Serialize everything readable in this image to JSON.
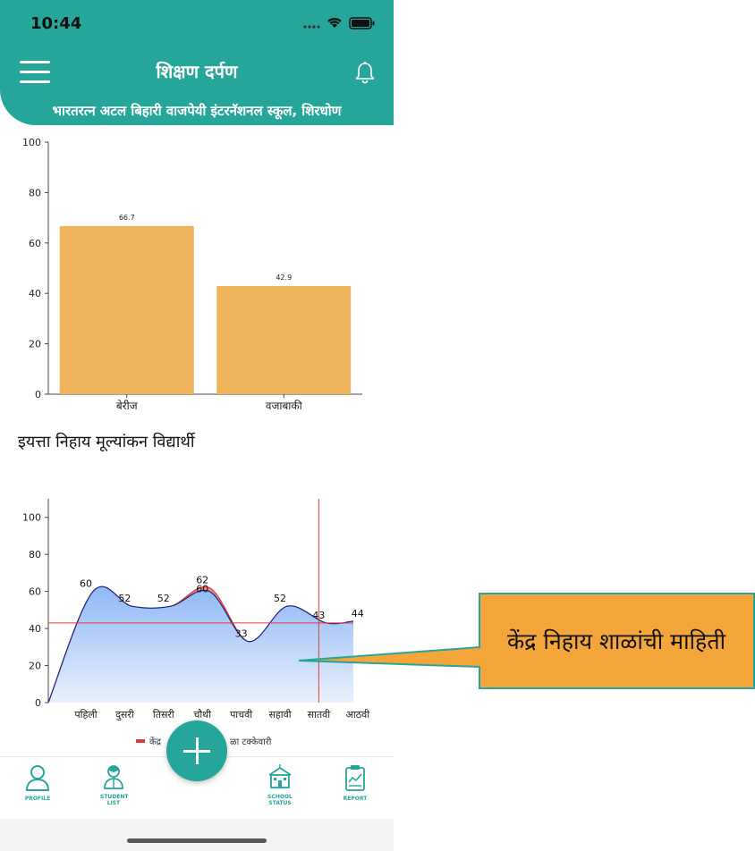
{
  "status": {
    "time": "10:44"
  },
  "header": {
    "title": "शिक्षण दर्पण",
    "school": "भारतरत्न अटल बिहारी वाजपेयी इंटरनॅशनल स्कूल, शिरधोण"
  },
  "section_label": "इयत्ता निहाय मूल्यांकन विद्यार्थी",
  "chart_data": [
    {
      "type": "bar",
      "categories": [
        "बेरीज",
        "वजाबाकी"
      ],
      "values": [
        66.7,
        42.9
      ],
      "data_labels": [
        "66.7",
        "42.9"
      ],
      "ylim": [
        0,
        100
      ],
      "yticks": [
        "0",
        "20",
        "40",
        "60",
        "80",
        "100"
      ],
      "color": "#efb35c"
    },
    {
      "type": "area",
      "categories": [
        "पहिली",
        "दुसरी",
        "तिसरी",
        "चौथी",
        "पाचवी",
        "सहावी",
        "सातवी",
        "आठवी"
      ],
      "series": [
        {
          "name": "केंद्र",
          "values": [
            60,
            52,
            52,
            62,
            33,
            52,
            43,
            44
          ],
          "color": "#e53935"
        },
        {
          "values": [
            60,
            52,
            52,
            60,
            33,
            52,
            43,
            44
          ],
          "color": "#1a237e"
        }
      ],
      "data_labels": [
        "60",
        "52",
        "52",
        "62",
        "60",
        "33",
        "52",
        "43",
        "44"
      ],
      "ylim": [
        0,
        110
      ],
      "yticks": [
        "0",
        "20",
        "40",
        "60",
        "80",
        "100"
      ],
      "reference_line": 43,
      "marker_category": "सातवी",
      "legend": "केंद्र",
      "legend_suffix": "ळा टक्केवारी"
    }
  ],
  "nav": [
    {
      "label": "PROFILE",
      "icon": "profile-icon"
    },
    {
      "label": "STUDENT LIST",
      "icon": "student-list-icon"
    },
    {
      "label": "SCHOOL STATUS",
      "icon": "school-icon"
    },
    {
      "label": "REPORT",
      "icon": "report-icon"
    }
  ],
  "callout": {
    "text": "केंद्र निहाय शाळांची माहिती",
    "color": "#f4a63b",
    "border": "#26a69a"
  }
}
